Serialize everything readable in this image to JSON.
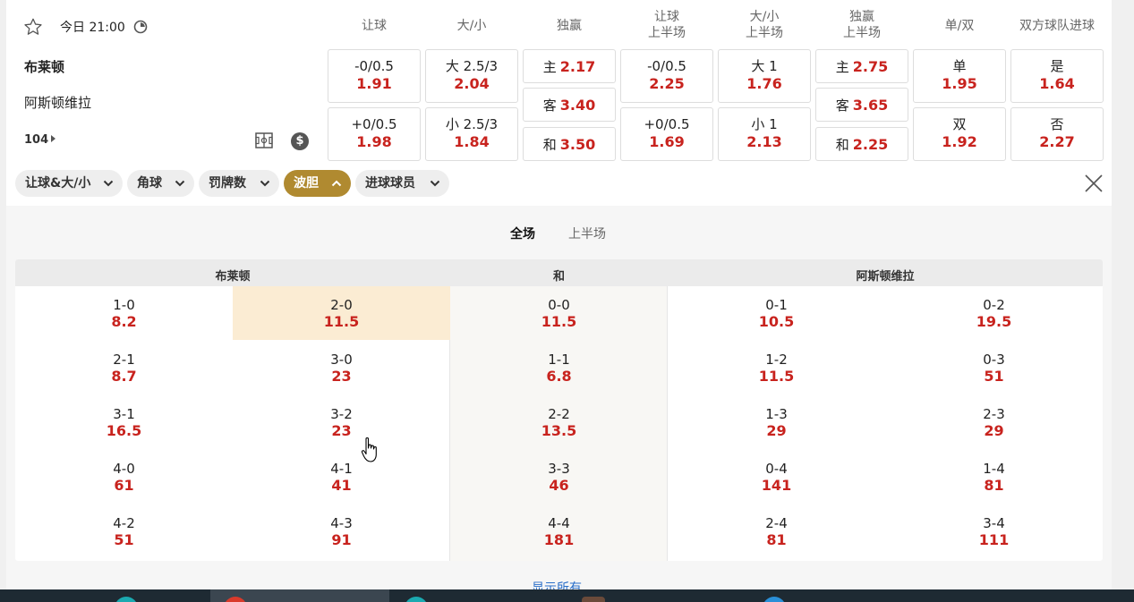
{
  "match": {
    "time": "今日 21:00",
    "home": "布莱顿",
    "away": "阿斯顿维拉",
    "markets_count": "104"
  },
  "market_headers": [
    {
      "l1": "让球",
      "l2": ""
    },
    {
      "l1": "大/小",
      "l2": ""
    },
    {
      "l1": "独赢",
      "l2": ""
    },
    {
      "l1": "让球",
      "l2": "上半场"
    },
    {
      "l1": "大/小",
      "l2": "上半场"
    },
    {
      "l1": "独赢",
      "l2": "上半场"
    },
    {
      "l1": "单/双",
      "l2": ""
    },
    {
      "l1": "双方球队进球",
      "l2": ""
    }
  ],
  "markets": {
    "hdp": [
      {
        "t": "-0/0.5",
        "o": "1.91"
      },
      {
        "t": "+0/0.5",
        "o": "1.98"
      }
    ],
    "ou": [
      {
        "t": "大 2.5/3",
        "o": "2.04"
      },
      {
        "t": "小 2.5/3",
        "o": "1.84"
      }
    ],
    "x12": [
      {
        "t": "主",
        "o": "2.17"
      },
      {
        "t": "客",
        "o": "3.40"
      },
      {
        "t": "和",
        "o": "3.50"
      }
    ],
    "hdp_1h": [
      {
        "t": "-0/0.5",
        "o": "2.25"
      },
      {
        "t": "+0/0.5",
        "o": "1.69"
      }
    ],
    "ou_1h": [
      {
        "t": "大 1",
        "o": "1.76"
      },
      {
        "t": "小 1",
        "o": "2.13"
      }
    ],
    "x12_1h": [
      {
        "t": "主",
        "o": "2.75"
      },
      {
        "t": "客",
        "o": "3.65"
      },
      {
        "t": "和",
        "o": "2.25"
      }
    ],
    "oe": [
      {
        "t": "单",
        "o": "1.95"
      },
      {
        "t": "双",
        "o": "1.92"
      }
    ],
    "btts": [
      {
        "t": "是",
        "o": "1.64"
      },
      {
        "t": "否",
        "o": "2.27"
      }
    ]
  },
  "filters": [
    "让球&大/小",
    "角球",
    "罚牌数",
    "波胆",
    "进球球员"
  ],
  "active_filter": "波胆",
  "tabs": [
    "全场",
    "上半场"
  ],
  "grid_headers": {
    "home": "布莱顿",
    "draw": "和",
    "away": "阿斯顿维拉"
  },
  "correct_score": {
    "home": [
      [
        {
          "s": "1-0",
          "o": "8.2"
        },
        {
          "s": "2-0",
          "o": "11.5"
        }
      ],
      [
        {
          "s": "2-1",
          "o": "8.7"
        },
        {
          "s": "3-0",
          "o": "23"
        }
      ],
      [
        {
          "s": "3-1",
          "o": "16.5"
        },
        {
          "s": "3-2",
          "o": "23"
        }
      ],
      [
        {
          "s": "4-0",
          "o": "61"
        },
        {
          "s": "4-1",
          "o": "41"
        }
      ],
      [
        {
          "s": "4-2",
          "o": "51"
        },
        {
          "s": "4-3",
          "o": "91"
        }
      ]
    ],
    "draw": [
      {
        "s": "0-0",
        "o": "11.5"
      },
      {
        "s": "1-1",
        "o": "6.8"
      },
      {
        "s": "2-2",
        "o": "13.5"
      },
      {
        "s": "3-3",
        "o": "46"
      },
      {
        "s": "4-4",
        "o": "181"
      }
    ],
    "away": [
      [
        {
          "s": "0-1",
          "o": "10.5"
        },
        {
          "s": "0-2",
          "o": "19.5"
        }
      ],
      [
        {
          "s": "1-2",
          "o": "11.5"
        },
        {
          "s": "0-3",
          "o": "51"
        }
      ],
      [
        {
          "s": "1-3",
          "o": "29"
        },
        {
          "s": "2-3",
          "o": "29"
        }
      ],
      [
        {
          "s": "0-4",
          "o": "141"
        },
        {
          "s": "1-4",
          "o": "81"
        }
      ],
      [
        {
          "s": "2-4",
          "o": "81"
        },
        {
          "s": "3-4",
          "o": "111"
        }
      ]
    ]
  },
  "show_all": "显示所有",
  "colors": {
    "accent": "#b08a30",
    "odds": "#c8231e",
    "highlight": "#fbecd3",
    "link": "#2a6fc9"
  }
}
